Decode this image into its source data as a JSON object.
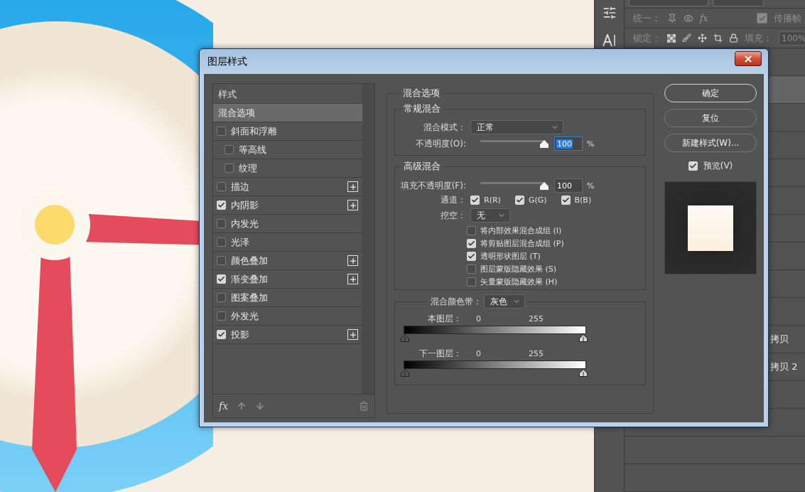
{
  "layers_panel": {
    "unify_label": "统一：",
    "fx_label": "fx",
    "propagate": {
      "label": "传播帧",
      "checked": true
    },
    "lock_label": "锁定：",
    "fill": {
      "label": "填充：",
      "value": "100%"
    },
    "layers": [
      {
        "selected": false
      },
      {
        "selected": true
      },
      {
        "selected": false
      },
      {
        "selected": false
      },
      {
        "selected": false
      },
      {
        "selected": false
      },
      {
        "selected": false
      },
      {
        "selected": false
      },
      {
        "selected": false
      },
      {
        "selected": false
      },
      {
        "selected": false,
        "name": "拷贝"
      },
      {
        "selected": false,
        "name": "拷贝 2"
      },
      {
        "selected": false
      },
      {
        "selected": false
      },
      {
        "selected": false
      },
      {
        "selected": false
      }
    ]
  },
  "dialog": {
    "title": "图层样式",
    "styles": {
      "header": "样式",
      "footer_label": "fx",
      "items": [
        {
          "label": "混合选项",
          "kind": "page",
          "selected": true
        },
        {
          "label": "斜面和浮雕",
          "kind": "effect",
          "checked": false,
          "selected": false,
          "addable": false,
          "children": [
            {
              "label": "等高线",
              "kind": "effect",
              "checked": false,
              "selected": false,
              "addable": false
            },
            {
              "label": "纹理",
              "kind": "effect",
              "checked": false,
              "selected": false,
              "addable": false
            }
          ]
        },
        {
          "label": "描边",
          "kind": "effect",
          "checked": false,
          "selected": false,
          "addable": true
        },
        {
          "label": "内阴影",
          "kind": "effect",
          "checked": true,
          "selected": false,
          "addable": true
        },
        {
          "label": "内发光",
          "kind": "effect",
          "checked": false,
          "selected": false,
          "addable": false
        },
        {
          "label": "光泽",
          "kind": "effect",
          "checked": false,
          "selected": false,
          "addable": false
        },
        {
          "label": "颜色叠加",
          "kind": "effect",
          "checked": false,
          "selected": false,
          "addable": true
        },
        {
          "label": "渐变叠加",
          "kind": "effect",
          "checked": true,
          "selected": false,
          "addable": true
        },
        {
          "label": "图案叠加",
          "kind": "effect",
          "checked": false,
          "selected": false,
          "addable": false
        },
        {
          "label": "外发光",
          "kind": "effect",
          "checked": false,
          "selected": false,
          "addable": false
        },
        {
          "label": "投影",
          "kind": "effect",
          "checked": true,
          "selected": false,
          "addable": true
        }
      ]
    },
    "blending": {
      "title": "混合选项",
      "general": {
        "title": "常规混合",
        "blend_mode": {
          "label": "混合模式：",
          "value": "正常"
        },
        "opacity": {
          "label": "不透明度(O):",
          "level": 1,
          "value": "100",
          "unit": "%",
          "focused": true
        }
      },
      "advanced": {
        "title": "高级混合",
        "fill_opacity": {
          "label": "填充不透明度(F):",
          "level": 1,
          "value": "100",
          "unit": "%",
          "focused": false
        },
        "channels": {
          "label": "通道：",
          "items": [
            {
              "label": "R(R)",
              "checked": true
            },
            {
              "label": "G(G)",
              "checked": true
            },
            {
              "label": "B(B)",
              "checked": true
            }
          ]
        },
        "knockout": {
          "label": "挖空：",
          "value": "无"
        },
        "options": [
          {
            "label": "将内部效果混合成组 (I)",
            "checked": false
          },
          {
            "label": "将剪贴图层混合成组 (P)",
            "checked": true
          },
          {
            "label": "透明形状图层 (T)",
            "checked": true
          },
          {
            "label": "图层蒙版隐藏效果 (S)",
            "checked": false
          },
          {
            "label": "矢量蒙版隐藏效果 (H)",
            "checked": false
          }
        ]
      },
      "blend_if": {
        "label": "混合颜色带：",
        "value": "灰色",
        "bands": [
          {
            "label": "本图层：",
            "low": "0",
            "high": "255"
          },
          {
            "label": "下一图层：",
            "low": "0",
            "high": "255"
          }
        ]
      }
    },
    "buttons": [
      {
        "label": "确定",
        "default": true
      },
      {
        "label": "复位",
        "default": false
      },
      {
        "label": "新建样式(W)...",
        "default": false
      }
    ],
    "preview": {
      "label": "预览(V)",
      "checked": true
    }
  }
}
